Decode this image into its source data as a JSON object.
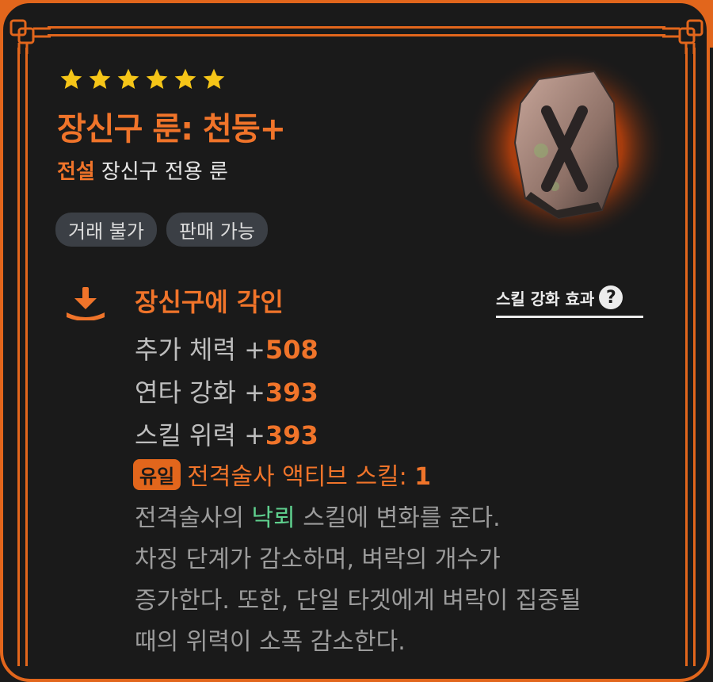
{
  "item": {
    "star_count": 6,
    "name": "장신구 룬: 천둥+",
    "grade": "전설",
    "type": "장신구 전용 룬",
    "tags": [
      "거래 불가",
      "판매 가능"
    ],
    "rune_symbol": "X"
  },
  "engrave": {
    "icon": "download-tray-icon",
    "title": "장신구에 각인",
    "skill_effect_link": "스킬 강화 효과",
    "help_icon": "question-circle-icon",
    "stats": [
      {
        "label": "추가 체력 +",
        "value": "508"
      },
      {
        "label": "연타 강화 +",
        "value": "393"
      },
      {
        "label": "스킬 위력 +",
        "value": "393"
      }
    ],
    "unique": {
      "badge": "유일",
      "text": "전격술사 액티브 스킬: ",
      "value": "1"
    },
    "description": {
      "line1_pre": "전격술사의 ",
      "line1_highlight": "낙뢰",
      "line1_post": " 스킬에 변화를 준다.",
      "line2": "차징 단계가 감소하며, 벼락의 개수가",
      "line3": "증가한다. 또한, 단일 타겟에게 벼락이 집중될",
      "line4": "때의 위력이 소폭 감소한다."
    }
  },
  "colors": {
    "accent": "#f0742a",
    "frame": "#e2661c",
    "background": "#1a1a1a",
    "highlight_green": "#5fd08e",
    "star": "#f5c518"
  }
}
